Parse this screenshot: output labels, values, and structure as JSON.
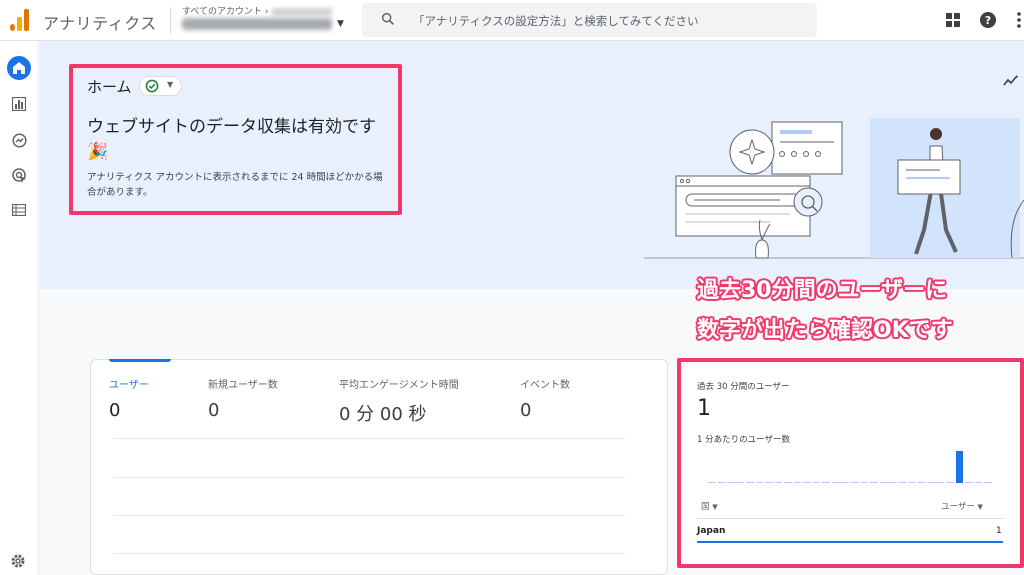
{
  "app": {
    "title": "アナリティクス"
  },
  "account": {
    "breadcrumb": "すべてのアカウント"
  },
  "search": {
    "placeholder": "「アナリティクスの設定方法」と検索してみてください"
  },
  "home": {
    "label": "ホーム",
    "title": "ウェブサイトのデータ収集は有効です 🎉",
    "description": "アナリティクス アカウントに表示されるまでに 24 時間ほどかかる場合があります。"
  },
  "metrics": [
    {
      "label": "ユーザー",
      "value": "0"
    },
    {
      "label": "新規ユーザー数",
      "value": "0"
    },
    {
      "label": "平均エンゲージメント時間",
      "value": "0 分 00 秒"
    },
    {
      "label": "イベント数",
      "value": "0"
    }
  ],
  "realtime": {
    "label": "過去 30 分間のユーザー",
    "value": "1",
    "sublabel": "1 分あたりのユーザー数",
    "per_minute": [
      0,
      0,
      0,
      0,
      0,
      0,
      0,
      0,
      0,
      0,
      0,
      0,
      0,
      0,
      0,
      0,
      0,
      0,
      0,
      0,
      0,
      0,
      0,
      0,
      0,
      0,
      1,
      0,
      0,
      0
    ],
    "dimension_label": "国",
    "metric_label": "ユーザー",
    "rows": [
      {
        "country": "Japan",
        "users": "1"
      }
    ]
  },
  "annotation": {
    "line1": "過去30分間のユーザーに",
    "line2": "数字が出たら確認OKです",
    "color": "#f0386b"
  },
  "colors": {
    "accent": "#1a73e8",
    "hero_bg": "#e8f0fe"
  }
}
